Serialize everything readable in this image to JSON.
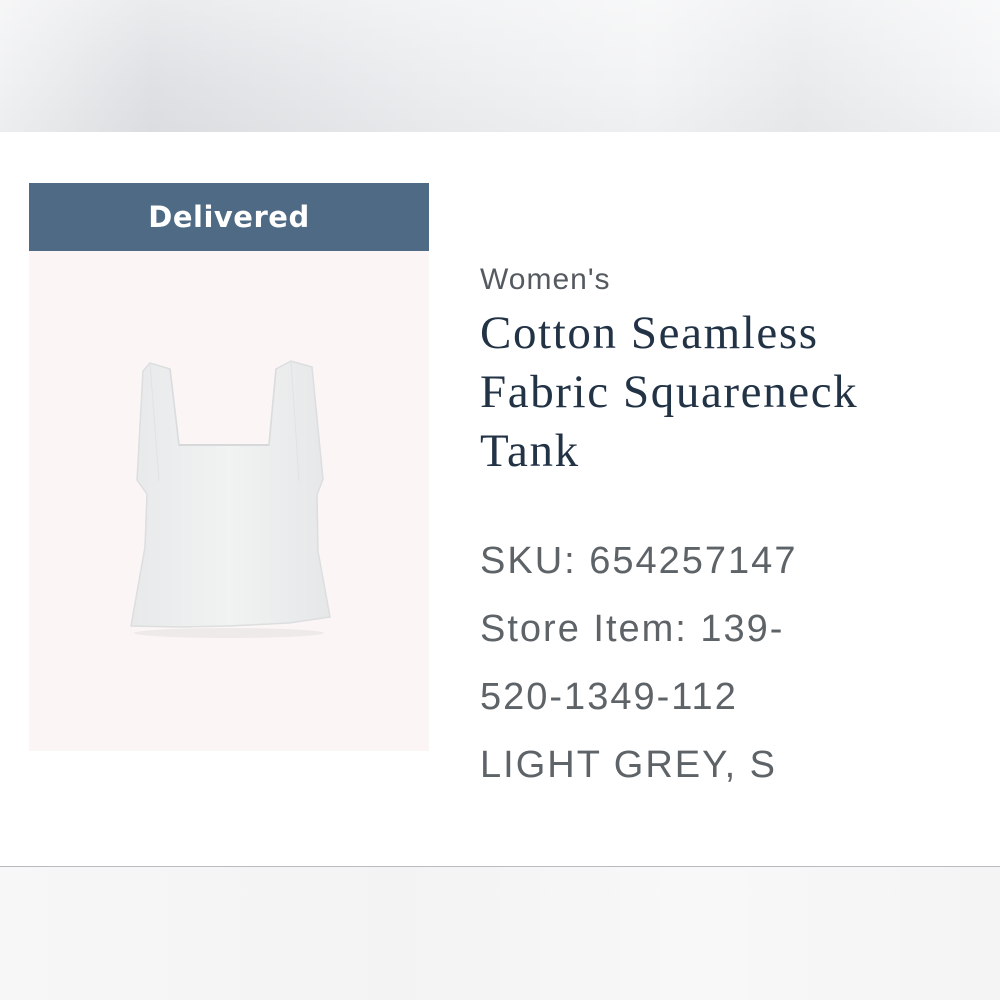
{
  "order_item": {
    "status": "Delivered",
    "category": "Women's",
    "title": "Cotton Seamless Fabric Squareneck Tank",
    "sku_line": "SKU: 654257147",
    "store_item_line_1": "Store Item: 139-",
    "store_item_line_2": "520-1349-112",
    "variant": "LIGHT GREY, S",
    "image_icon": "tank-top-product-image"
  },
  "colors": {
    "status_banner": "#4e6a84",
    "title": "#233346",
    "detail_text": "#5e6368",
    "image_bg": "#fbf6f5"
  }
}
